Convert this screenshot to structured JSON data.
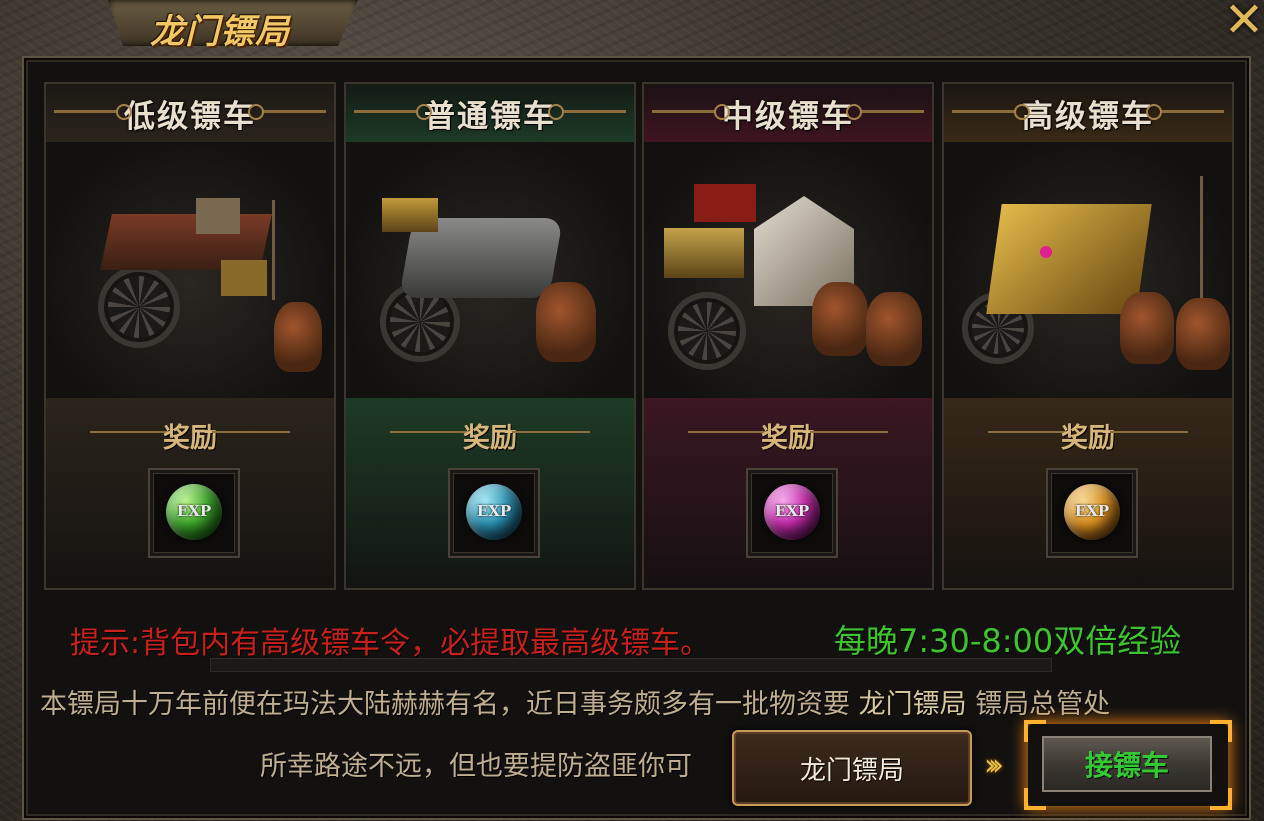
{
  "window": {
    "title": "龙门镖局",
    "close_icon": "close-x-icon"
  },
  "colors": {
    "title_gold": "#f2c865",
    "tip_red": "#c8201a",
    "double_green": "#3ec52e",
    "accept_green": "#33c933",
    "highlight_orange": "#ffb030"
  },
  "cards": [
    {
      "title": "低级镖车",
      "reward_label": "奖励",
      "orb_text": "EXP",
      "orb_color": "#3aa42a",
      "accent": "#7a6443"
    },
    {
      "title": "普通镖车",
      "reward_label": "奖励",
      "orb_text": "EXP",
      "orb_color": "#2a8fb0",
      "accent": "#2f7a4c"
    },
    {
      "title": "中级镖车",
      "reward_label": "奖励",
      "orb_text": "EXP",
      "orb_color": "#c02aa8",
      "accent": "#8a1f3e"
    },
    {
      "title": "高级镖车",
      "reward_label": "奖励",
      "orb_text": "EXP",
      "orb_color": "#d68c1e",
      "accent": "#8a6a2a"
    }
  ],
  "tip": "提示:背包内有高级镖车令，必提取最高级镖车。",
  "double_exp": "每晚7:30-8:00双倍经验",
  "description": {
    "line1": "本镖局十万年前便在玛法大陆赫赫有名，近日事务颇多有一批物资要",
    "line1_name": "龙门镖局",
    "line1_tail": "镖局总管处",
    "line2": "所幸路途不远，但也要提防盗匪你可"
  },
  "tooltip": "龙门镖局",
  "accept_button": "接镖车"
}
